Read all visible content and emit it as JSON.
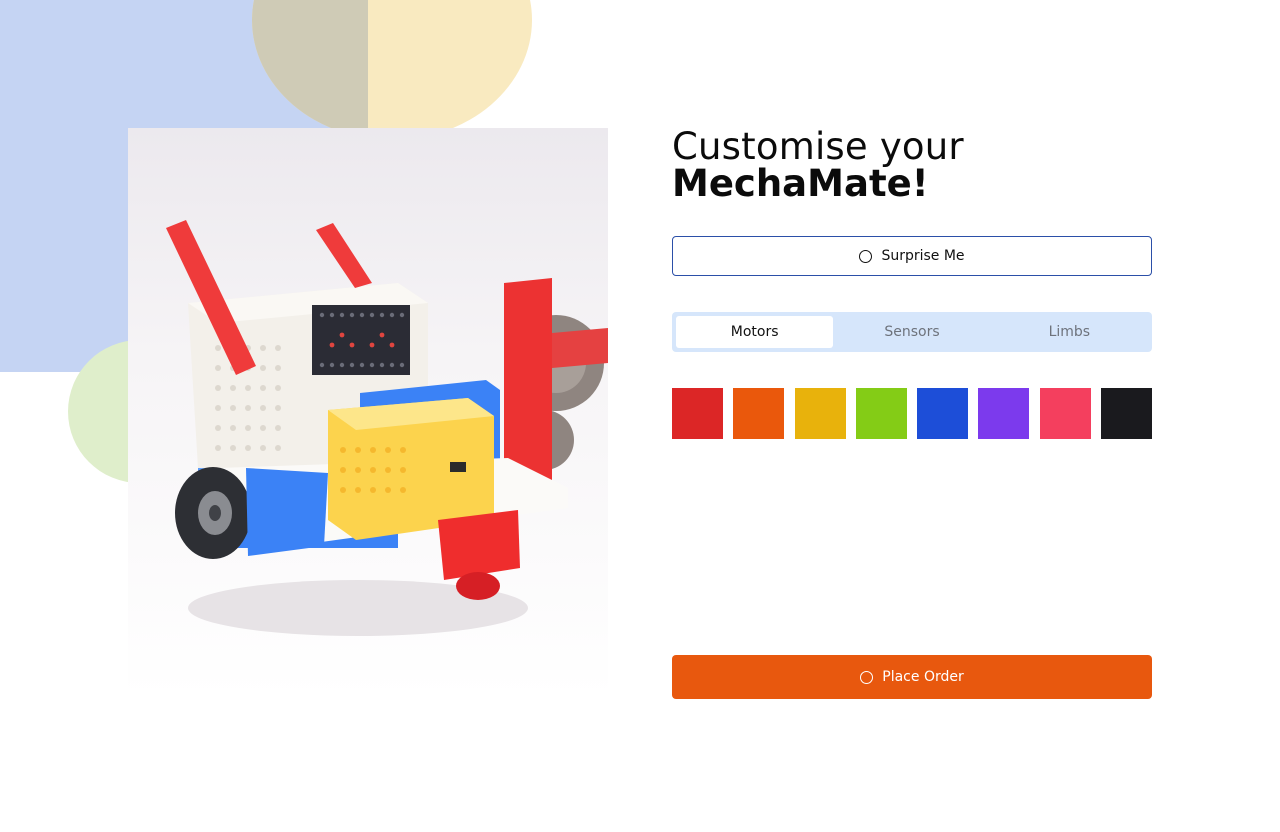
{
  "header": {
    "title_line1": "Customise your",
    "title_line2": "MechaMate!"
  },
  "actions": {
    "surprise_label": "Surprise Me",
    "surprise_icon": "circle-icon",
    "order_label": "Place Order",
    "order_icon": "circle-icon"
  },
  "tabs": [
    {
      "label": "Motors",
      "active": true
    },
    {
      "label": "Sensors",
      "active": false
    },
    {
      "label": "Limbs",
      "active": false
    }
  ],
  "swatches": [
    {
      "name": "red",
      "color": "#dc2626"
    },
    {
      "name": "orange",
      "color": "#ea580c"
    },
    {
      "name": "amber",
      "color": "#e8b20c"
    },
    {
      "name": "lime",
      "color": "#84cc16"
    },
    {
      "name": "blue",
      "color": "#1d4ed8"
    },
    {
      "name": "violet",
      "color": "#7c3aed"
    },
    {
      "name": "rose",
      "color": "#f43f5e"
    },
    {
      "name": "black",
      "color": "#1a1a1e"
    }
  ],
  "colors": {
    "accent": "#e8580e",
    "outline": "#2b4fa8",
    "tab_bg": "#d6e6fb"
  }
}
